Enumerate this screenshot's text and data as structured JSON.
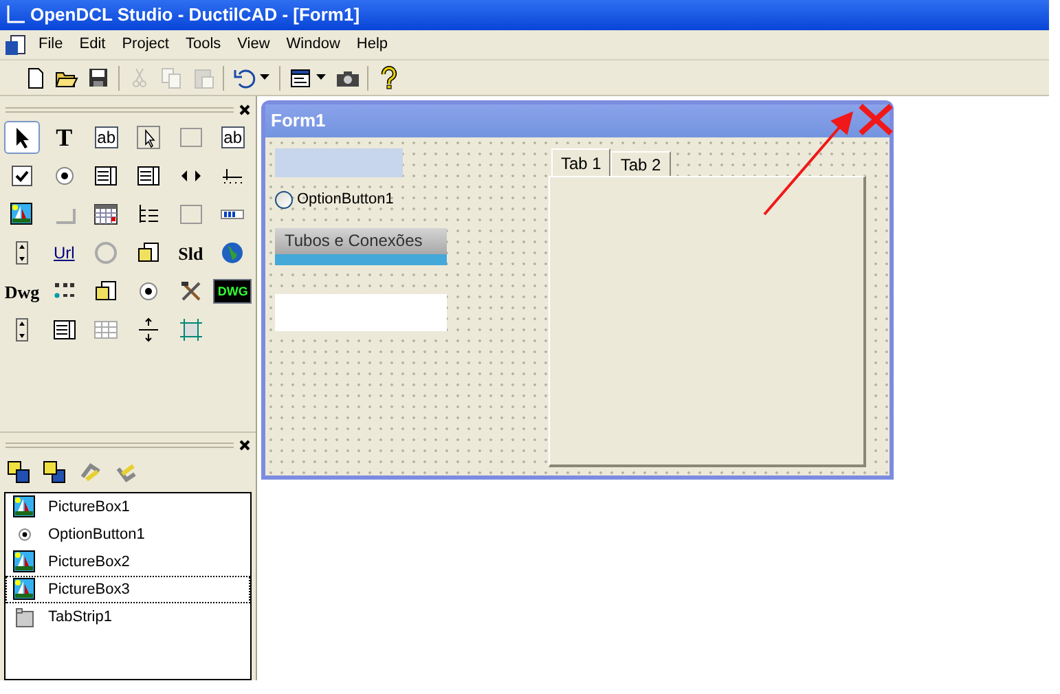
{
  "window": {
    "title": "OpenDCL Studio - DuctilCAD - [Form1]"
  },
  "menu": [
    "File",
    "Edit",
    "Project",
    "Tools",
    "View",
    "Window",
    "Help"
  ],
  "toolbar": [
    {
      "kind": "new",
      "disabled": false
    },
    {
      "kind": "open",
      "disabled": false
    },
    {
      "kind": "save",
      "disabled": false
    },
    {
      "kind": "sep"
    },
    {
      "kind": "cut",
      "disabled": true
    },
    {
      "kind": "copy",
      "disabled": true
    },
    {
      "kind": "paste",
      "disabled": true
    },
    {
      "kind": "sep"
    },
    {
      "kind": "undo",
      "disabled": false
    },
    {
      "kind": "drop"
    },
    {
      "kind": "sep"
    },
    {
      "kind": "form",
      "disabled": false
    },
    {
      "kind": "drop"
    },
    {
      "kind": "camera",
      "disabled": false
    },
    {
      "kind": "sep"
    },
    {
      "kind": "help",
      "disabled": false
    }
  ],
  "toolbox": {
    "tools": [
      {
        "kind": "pointer",
        "selected": true
      },
      {
        "kind": "glyph",
        "glyph": "T",
        "selected": false
      },
      {
        "kind": "boxglyph",
        "glyph": "ab",
        "selected": false
      },
      {
        "kind": "pointer2",
        "selected": false
      },
      {
        "kind": "frame",
        "selected": false
      },
      {
        "kind": "boxglyph",
        "glyph": "ab",
        "selected": false
      },
      {
        "kind": "check",
        "selected": false
      },
      {
        "kind": "radio",
        "selected": false
      },
      {
        "kind": "list",
        "selected": false
      },
      {
        "kind": "list",
        "selected": false
      },
      {
        "kind": "scroll",
        "selected": false
      },
      {
        "kind": "slider",
        "selected": false
      },
      {
        "kind": "picture",
        "selected": false
      },
      {
        "kind": "corner",
        "selected": false
      },
      {
        "kind": "calendar",
        "selected": false
      },
      {
        "kind": "tree",
        "selected": false
      },
      {
        "kind": "frame",
        "selected": false
      },
      {
        "kind": "progress",
        "selected": false
      },
      {
        "kind": "spin",
        "selected": false
      },
      {
        "kind": "link",
        "glyph": "Url",
        "selected": false
      },
      {
        "kind": "circle",
        "selected": false
      },
      {
        "kind": "docs",
        "selected": false
      },
      {
        "kind": "glyph",
        "glyph": "Sld",
        "selected": false
      },
      {
        "kind": "globe",
        "selected": false
      },
      {
        "kind": "glyph",
        "glyph": "Dwg",
        "selected": false
      },
      {
        "kind": "options",
        "selected": false
      },
      {
        "kind": "docs",
        "selected": false
      },
      {
        "kind": "radio",
        "selected": false
      },
      {
        "kind": "tools",
        "selected": false
      },
      {
        "kind": "dwg",
        "glyph": "DWG",
        "selected": false
      },
      {
        "kind": "spin",
        "selected": false
      },
      {
        "kind": "list",
        "selected": false
      },
      {
        "kind": "grid",
        "selected": false
      },
      {
        "kind": "splitter",
        "selected": false
      },
      {
        "kind": "hatch",
        "selected": false
      }
    ]
  },
  "objects": {
    "tools": [
      {
        "kind": "front"
      },
      {
        "kind": "back"
      },
      {
        "kind": "up"
      },
      {
        "kind": "down"
      }
    ],
    "items": [
      {
        "kind": "picture",
        "label": "PictureBox1",
        "selected": false
      },
      {
        "kind": "radio",
        "label": "OptionButton1",
        "selected": false
      },
      {
        "kind": "picture",
        "label": "PictureBox2",
        "selected": false
      },
      {
        "kind": "picture",
        "label": "PictureBox3",
        "selected": true
      },
      {
        "kind": "tab",
        "label": "TabStrip1",
        "selected": false
      }
    ]
  },
  "form": {
    "title": "Form1",
    "option": {
      "label": "OptionButton1",
      "selected": false
    },
    "banner": "Tubos e Conexões",
    "tabs": [
      {
        "label": "Tab 1",
        "selected": true
      },
      {
        "label": "Tab 2",
        "selected": false
      }
    ]
  }
}
